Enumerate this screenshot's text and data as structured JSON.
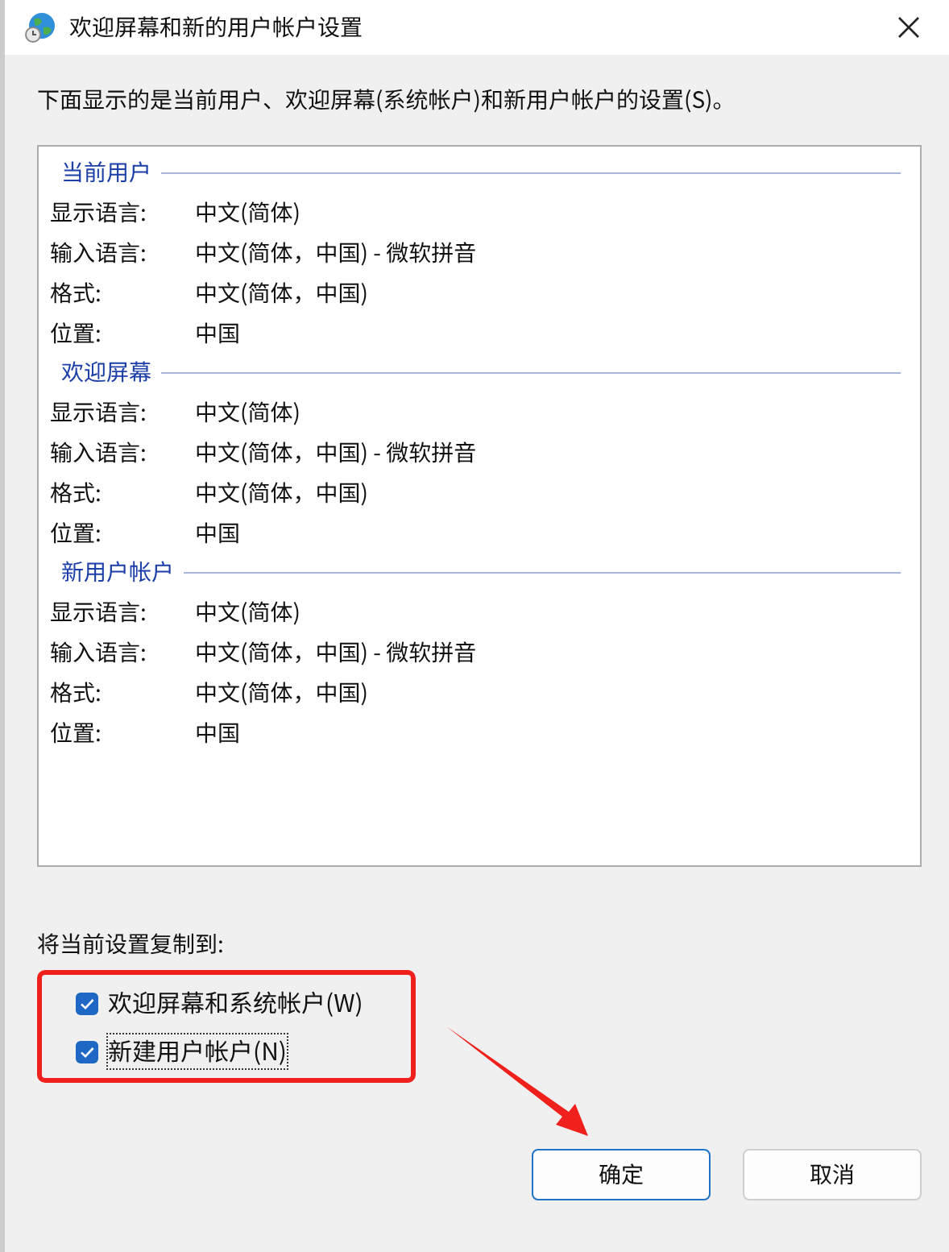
{
  "window": {
    "title": "欢迎屏幕和新的用户帐户设置"
  },
  "description": "下面显示的是当前用户、欢迎屏幕(系统帐户)和新用户帐户的设置(S)。",
  "groups": [
    {
      "title": "当前用户",
      "rows": [
        {
          "label": "显示语言:",
          "value": "中文(简体)"
        },
        {
          "label": "输入语言:",
          "value": "中文(简体，中国) - 微软拼音"
        },
        {
          "label": "格式:",
          "value": "中文(简体，中国)"
        },
        {
          "label": "位置:",
          "value": "中国"
        }
      ]
    },
    {
      "title": "欢迎屏幕",
      "rows": [
        {
          "label": "显示语言:",
          "value": "中文(简体)"
        },
        {
          "label": "输入语言:",
          "value": "中文(简体，中国) - 微软拼音"
        },
        {
          "label": "格式:",
          "value": "中文(简体，中国)"
        },
        {
          "label": "位置:",
          "value": "中国"
        }
      ]
    },
    {
      "title": "新用户帐户",
      "rows": [
        {
          "label": "显示语言:",
          "value": "中文(简体)"
        },
        {
          "label": "输入语言:",
          "value": "中文(简体，中国) - 微软拼音"
        },
        {
          "label": "格式:",
          "value": "中文(简体，中国)"
        },
        {
          "label": "位置:",
          "value": "中国"
        }
      ]
    }
  ],
  "copy_to": {
    "label": "将当前设置复制到:",
    "options": [
      {
        "label": "欢迎屏幕和系统帐户(W)",
        "checked": true,
        "focused": false
      },
      {
        "label": "新建用户帐户(N)",
        "checked": true,
        "focused": true
      }
    ]
  },
  "buttons": [
    {
      "label": "确定",
      "default": true
    },
    {
      "label": "取消",
      "default": false
    }
  ]
}
